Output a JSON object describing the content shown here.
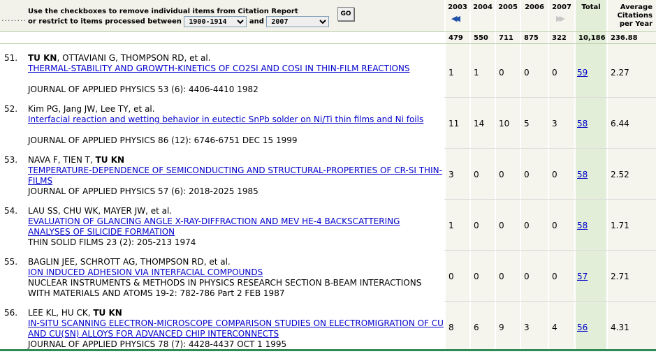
{
  "header": {
    "instruction_line1": "Use the checkboxes to remove individual items from Citation Report",
    "instruction_line2_prefix": "or restrict to items processed between",
    "instruction_and": "and",
    "from_select_value": "1900-1914",
    "to_select_value": "2007",
    "go_label": "GO",
    "dots": "........",
    "years": [
      "2003",
      "2004",
      "2005",
      "2006",
      "2007"
    ],
    "total_label": "Total",
    "avg_label_line1": "Average",
    "avg_label_line2": "Citations",
    "avg_label_line3": "per Year",
    "prev_arrow": "◀◀",
    "next_arrow": "▶▶"
  },
  "summary": {
    "year_totals": [
      "479",
      "550",
      "711",
      "875",
      "322"
    ],
    "total": "10,186",
    "average": "236.88"
  },
  "records": [
    {
      "num": "51.",
      "authors_bold": "TU KN",
      "authors_rest": ", OTTAVIANI G, THOMPSON RD, et al.",
      "title": "THERMAL-STABILITY AND GROWTH-KINETICS OF CO2SI AND COSI IN THIN-FILM REACTIONS",
      "source": "JOURNAL OF APPLIED PHYSICS 53 (6): 4406-4410 1982",
      "counts": [
        "1",
        "1",
        "0",
        "0",
        "0"
      ],
      "total": "59",
      "avg": "2.27"
    },
    {
      "num": "52.",
      "authors_bold": "",
      "authors_rest": "Kim PG, Jang JW, Lee TY, et al.",
      "title": "Interfacial reaction and wetting behavior in eutectic SnPb solder on Ni/Ti thin films and Ni foils",
      "source": "JOURNAL OF APPLIED PHYSICS 86 (12): 6746-6751 DEC 15 1999",
      "counts": [
        "11",
        "14",
        "10",
        "5",
        "3"
      ],
      "total": "58",
      "avg": "6.44"
    },
    {
      "num": "53.",
      "authors_pre": "NAVA F, TIEN T, ",
      "authors_bold": "TU KN",
      "authors_rest": "",
      "title": "TEMPERATURE-DEPENDENCE OF SEMICONDUCTING AND STRUCTURAL-PROPERTIES OF CR-SI THIN-FILMS",
      "source": "JOURNAL OF APPLIED PHYSICS 57 (6): 2018-2025 1985",
      "counts": [
        "3",
        "0",
        "0",
        "0",
        "0"
      ],
      "total": "58",
      "avg": "2.52"
    },
    {
      "num": "54.",
      "authors_bold": "",
      "authors_rest": "LAU SS, CHU WK, MAYER JW, et al.",
      "title": "EVALUATION OF GLANCING ANGLE X-RAY-DIFFRACTION AND MEV HE-4 BACKSCATTERING ANALYSES OF SILICIDE FORMATION",
      "source": "THIN SOLID FILMS 23 (2): 205-213 1974",
      "counts": [
        "1",
        "0",
        "0",
        "0",
        "0"
      ],
      "total": "58",
      "avg": "1.71"
    },
    {
      "num": "55.",
      "authors_bold": "",
      "authors_rest": "BAGLIN JEE, SCHROTT AG, THOMPSON RD, et al.",
      "title": "ION INDUCED ADHESION VIA INTERFACIAL COMPOUNDS",
      "source": "NUCLEAR INSTRUMENTS & METHODS IN PHYSICS RESEARCH SECTION B-BEAM INTERACTIONS WITH MATERIALS AND ATOMS 19-2: 782-786 Part 2 FEB 1987",
      "counts": [
        "0",
        "0",
        "0",
        "0",
        "0"
      ],
      "total": "57",
      "avg": "2.71"
    },
    {
      "num": "56.",
      "authors_pre": "LEE KL, HU CK, ",
      "authors_bold": "TU KN",
      "authors_rest": "",
      "title": "IN-SITU SCANNING ELECTRON-MICROSCOPE COMPARISON STUDIES ON ELECTROMIGRATION OF CU AND CU(SN) ALLOYS FOR ADVANCED CHIP INTERCONNECTS",
      "source": "JOURNAL OF APPLIED PHYSICS 78 (7): 4428-4437 OCT 1 1995",
      "counts": [
        "8",
        "6",
        "9",
        "3",
        "4"
      ],
      "total": "56",
      "avg": "4.31"
    }
  ]
}
